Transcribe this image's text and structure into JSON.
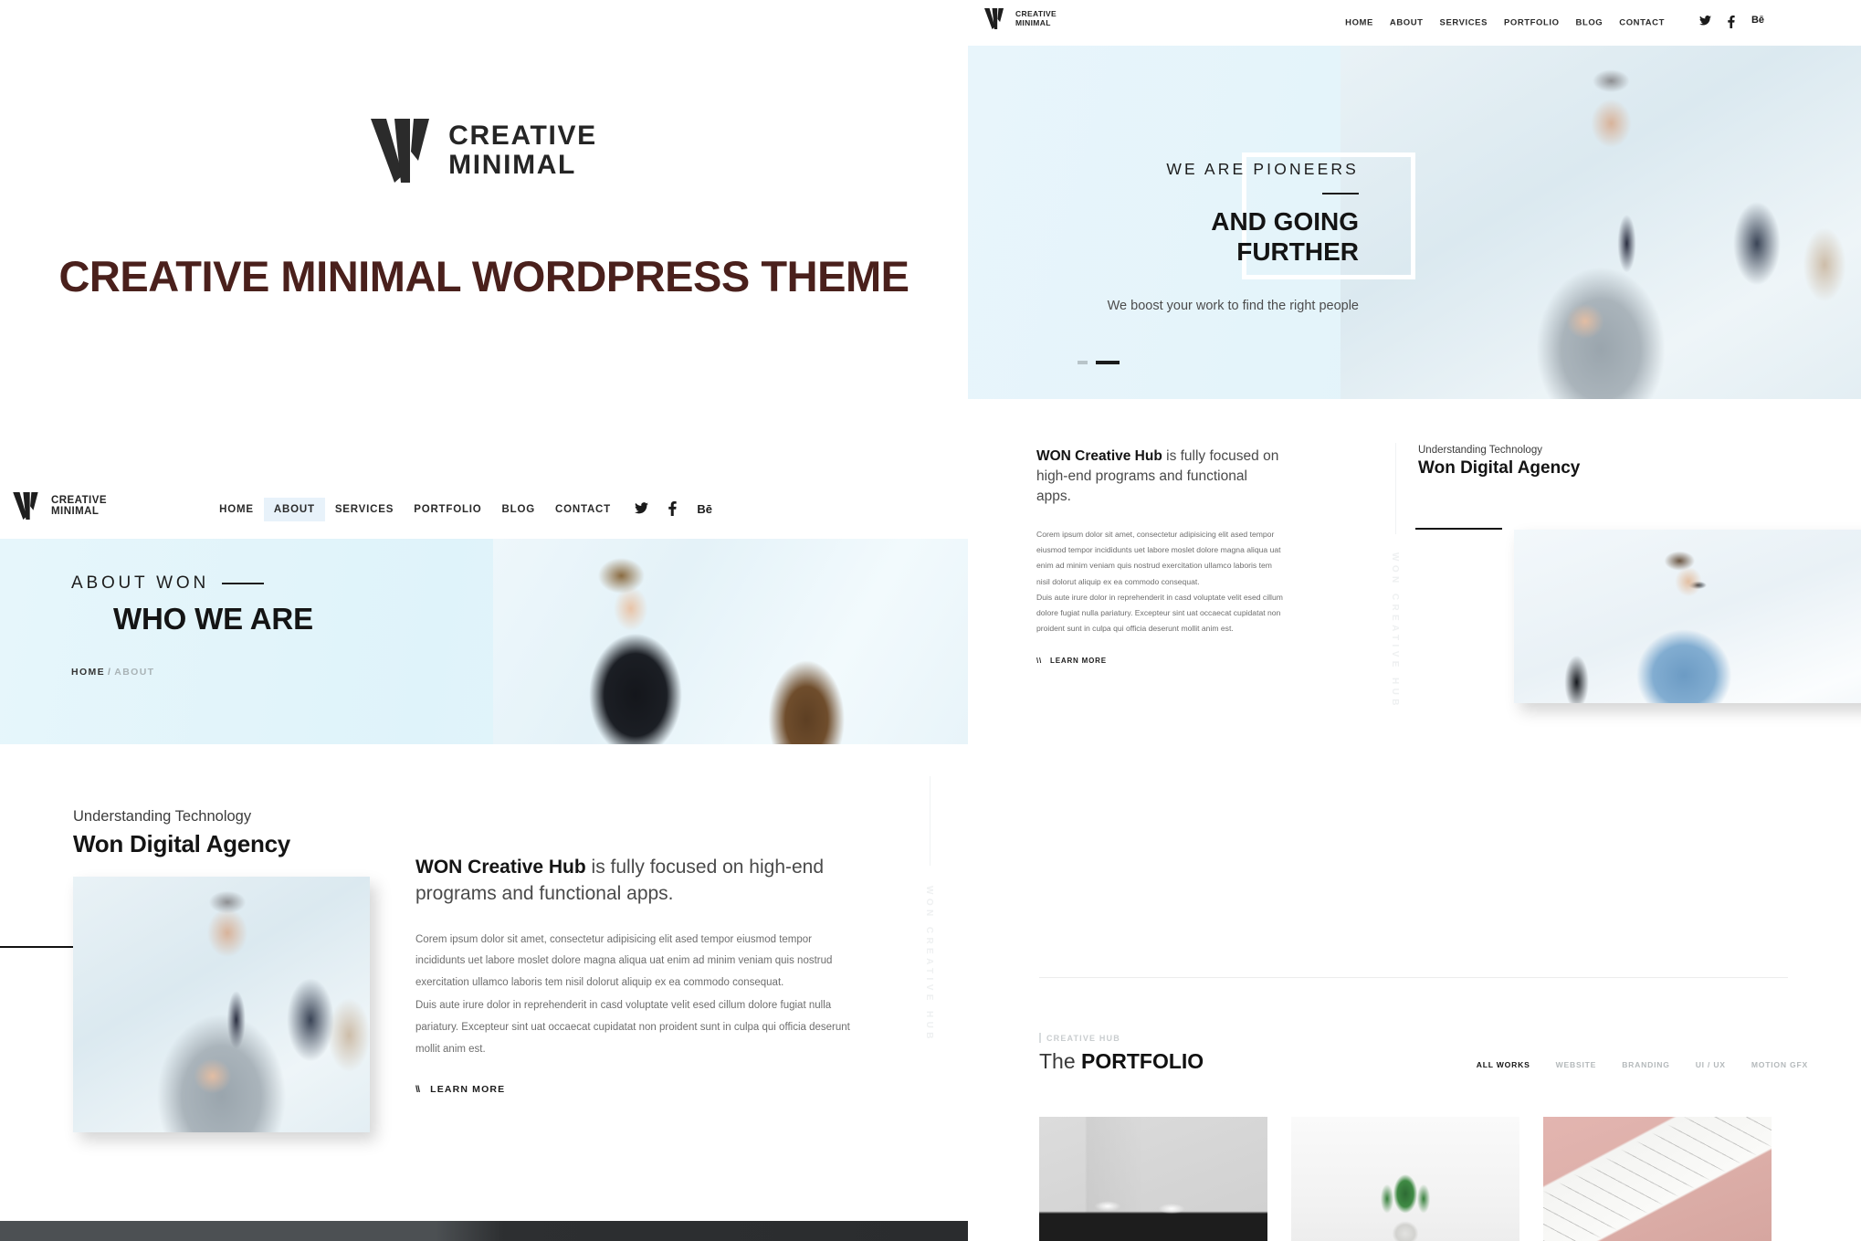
{
  "brand": {
    "logo_line1": "CREATIVE",
    "logo_line2": "MINIMAL",
    "logo_mark": "w-logo-icon"
  },
  "promo": {
    "title": "CREATIVE MINIMAL WORDPRESS THEME",
    "title_color": "#4a201c"
  },
  "nav": {
    "items": [
      {
        "label": "HOME",
        "active": false
      },
      {
        "label": "ABOUT",
        "active": true
      },
      {
        "label": "SERVICES",
        "active": false
      },
      {
        "label": "PORTFOLIO",
        "active": false
      },
      {
        "label": "BLOG",
        "active": false
      },
      {
        "label": "CONTACT",
        "active": false
      }
    ],
    "active_bg": "#e8f2fa",
    "social": [
      {
        "name": "twitter-icon",
        "glyph": "🐦"
      },
      {
        "name": "facebook-icon",
        "glyph": "f"
      },
      {
        "name": "behance-icon",
        "glyph": "Bē"
      }
    ]
  },
  "nav_right": {
    "items": [
      {
        "label": "HOME"
      },
      {
        "label": "ABOUT"
      },
      {
        "label": "SERVICES"
      },
      {
        "label": "PORTFOLIO"
      },
      {
        "label": "BLOG"
      },
      {
        "label": "CONTACT"
      }
    ]
  },
  "about_hero": {
    "kicker": "ABOUT WON",
    "heading": "WHO WE ARE",
    "breadcrumb_home": "HOME",
    "breadcrumb_sep": "/",
    "breadcrumb_current": "ABOUT",
    "bg_color": "#e4f3fa"
  },
  "about_section": {
    "eyebrow": "Understanding Technology",
    "title": "Won Digital Agency",
    "lead_bold": "WON Creative Hub",
    "lead_rest": " is fully focused on high-end programs and functional apps.",
    "paragraph_1": "Corem ipsum dolor sit amet, consectetur adipisicing elit ased tempor eiusmod tempor incididunts uet labore moslet dolore magna aliqua uat enim ad minim veniam quis nostrud exercitation ullamco laboris tem nisil dolorut aliquip ex ea commodo consequat.",
    "paragraph_2": "Duis aute irure dolor in reprehenderit in casd voluptate velit esed cillum dolore fugiat nulla pariatury. Excepteur sint uat occaecat cupidatat non proident sunt in culpa qui officia deserunt mollit anim est.",
    "learn_more": "LEARN MORE",
    "learn_more_glyph": "\\\\",
    "vertical_label": "WON CREATIVE HUB"
  },
  "hero_slider": {
    "kicker": "WE ARE PIONEERS",
    "heading_line1": "AND GOING",
    "heading_line2": "FURTHER",
    "subtext": "We boost your work to find the right people",
    "slides": [
      {
        "active": false
      },
      {
        "active": true
      }
    ]
  },
  "portfolio": {
    "kicker": "CREATIVE HUB",
    "title_light": "The",
    "title_bold": "PORTFOLIO",
    "filters": [
      {
        "label": "ALL WORKS",
        "active": true
      },
      {
        "label": "WEBSITE",
        "active": false
      },
      {
        "label": "BRANDING",
        "active": false
      },
      {
        "label": "UI / UX",
        "active": false
      },
      {
        "label": "MOTION GFX",
        "active": false
      }
    ],
    "items": [
      {
        "name": "coffee-cups-thumbnail",
        "style": "ph-cups"
      },
      {
        "name": "succulent-plant-thumbnail",
        "style": "ph-plant"
      },
      {
        "name": "packaging-mockup-thumbnail",
        "style": "ph-pink"
      }
    ]
  },
  "photos": {
    "hero_meeting_alt": "two-women-meeting-photo",
    "businessman_alt": "businessman-handshake-photo",
    "denim_alt": "man-at-desk-photo",
    "slider_alt": "businessman-handshake-slider-photo"
  }
}
